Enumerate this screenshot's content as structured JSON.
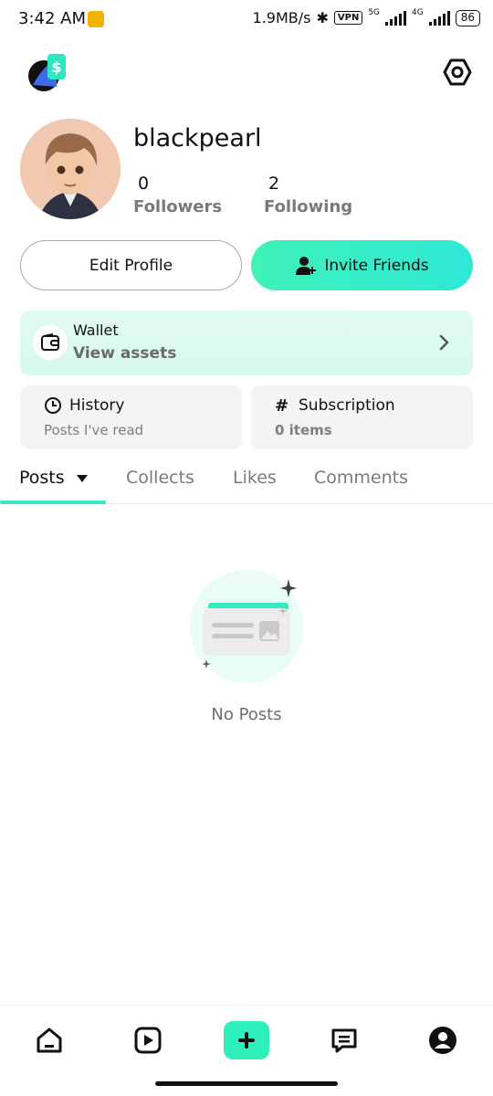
{
  "status_bar": {
    "time": "3:42 AM",
    "speed": "1.9MB/s",
    "vpn": "VPN",
    "net1": "5G",
    "net2": "4G",
    "battery": "86"
  },
  "profile": {
    "username": "blackpearl",
    "followers_count": "0",
    "followers_label": "Followers",
    "following_count": "2",
    "following_label": "Following"
  },
  "actions": {
    "edit_profile": "Edit Profile",
    "invite_friends": "Invite Friends"
  },
  "wallet": {
    "title": "Wallet",
    "subtitle": "View assets"
  },
  "history": {
    "title": "History",
    "subtitle": "Posts I've read"
  },
  "subscription": {
    "title": "Subscription",
    "subtitle": "0 items"
  },
  "tabs": [
    "Posts",
    "Collects",
    "Likes",
    "Comments"
  ],
  "empty_state": {
    "text": "No Posts"
  },
  "colors": {
    "accent": "#38e8c4",
    "wallet_bg": "#dcfaf2"
  },
  "icons": {
    "settings": "gear-icon",
    "wallet": "wallet-icon",
    "history": "clock-icon",
    "subscription": "hash-icon",
    "nav": [
      "home-icon",
      "play-icon",
      "plus-icon",
      "message-icon",
      "profile-icon"
    ]
  }
}
